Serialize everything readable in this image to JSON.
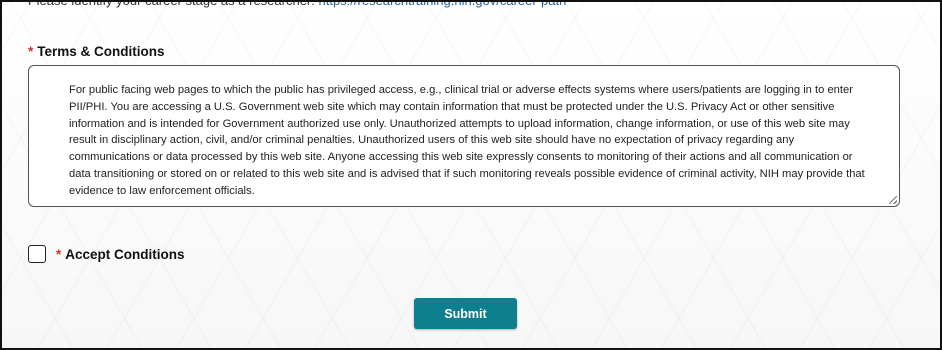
{
  "top_note": {
    "text": "Please identify your career stage as a researcher:",
    "link": "https://researchtraining.nih.gov/career-path"
  },
  "terms": {
    "label": "Terms & Conditions",
    "required_marker": "*",
    "body": "For public facing web pages to which the public has privileged access, e.g., clinical trial or adverse effects systems where users/patients are logging in to enter PII/PHI. You are accessing a U.S. Government web site which may contain information that must be protected under the U.S. Privacy Act or other sensitive information and is intended for Government authorized use only. Unauthorized attempts to upload information, change information, or use of this web site may result in disciplinary action, civil, and/or criminal penalties. Unauthorized users of this web site should have no expectation of privacy regarding any communications or data processed by this web site. Anyone accessing this web site expressly consents to monitoring of their actions and all communication or data transitioning or stored on or related to this web site and is advised that if such monitoring reveals possible evidence of criminal activity, NIH may provide that evidence to law enforcement officials."
  },
  "accept": {
    "label": "Accept Conditions",
    "required_marker": "*",
    "checked": false
  },
  "submit": {
    "label": "Submit"
  },
  "colors": {
    "required": "#c0392b",
    "button": "#0e7f8f",
    "link": "#2a6496"
  }
}
